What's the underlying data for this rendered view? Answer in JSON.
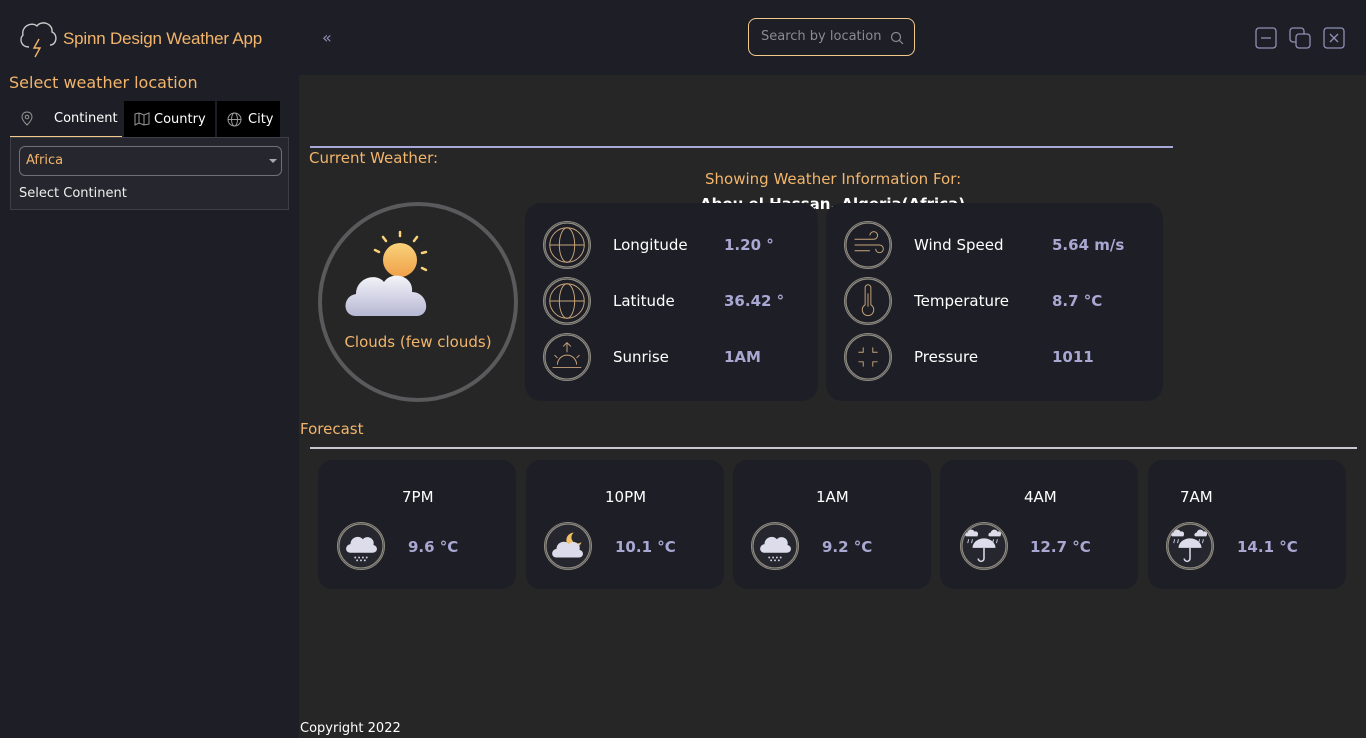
{
  "app": {
    "title": "Spinn Design Weather App",
    "logo_icon": "cloud-lightning-icon"
  },
  "header": {
    "collapse_icon": "double-chevron-left-icon",
    "search": {
      "placeholder": "Search by location",
      "icon": "search-icon"
    },
    "window_controls": [
      "minimize-icon",
      "restore-icon",
      "close-icon"
    ]
  },
  "sidebar": {
    "title": "Select weather location",
    "tabs": [
      {
        "label": "Continent",
        "icon": "map-pin-icon",
        "active": true
      },
      {
        "label": "Country",
        "icon": "map-icon",
        "active": false
      },
      {
        "label": "City",
        "icon": "globe-icon",
        "active": false
      }
    ],
    "select": {
      "value": "Africa",
      "label": "Select Continent"
    }
  },
  "main": {
    "showing_label": "Showing Weather Information For:",
    "location": "Abou el Hassan, Algeria(Africa)",
    "current_title": "Current Weather:",
    "current": {
      "condition": "Clouds (few clouds)",
      "condition_icon": "sun-behind-cloud-icon",
      "left_card": [
        {
          "label": "Longitude",
          "value": "1.20 °",
          "icon": "globe-icon"
        },
        {
          "label": "Latitude",
          "value": "36.42 °",
          "icon": "globe-icon"
        },
        {
          "label": "Sunrise",
          "value": "1AM",
          "icon": "sunrise-icon"
        }
      ],
      "right_card": [
        {
          "label": "Wind Speed",
          "value": "5.64 m/s",
          "icon": "wind-icon"
        },
        {
          "label": "Temperature",
          "value": "8.7 °C",
          "icon": "thermometer-icon"
        },
        {
          "label": "Pressure",
          "value": "1011",
          "icon": "pressure-icon"
        }
      ]
    },
    "forecast_title": "Forecast",
    "forecast": [
      {
        "time": "7PM",
        "temp": "9.6 °C",
        "icon": "snow-cloud-icon"
      },
      {
        "time": "10PM",
        "temp": "10.1 °C",
        "icon": "moon-cloud-icon"
      },
      {
        "time": "1AM",
        "temp": "9.2 °C",
        "icon": "snow-cloud-icon"
      },
      {
        "time": "4AM",
        "temp": "12.7 °C",
        "icon": "rain-umbrella-icon"
      },
      {
        "time": "7AM",
        "temp": "14.1 °C",
        "icon": "rain-umbrella-icon"
      }
    ]
  },
  "footer": {
    "copyright": "Copyright 2022"
  },
  "colors": {
    "accent": "#f2b56b",
    "value": "#a9a8d2",
    "panel": "#1e1f26",
    "background": "#262627"
  }
}
